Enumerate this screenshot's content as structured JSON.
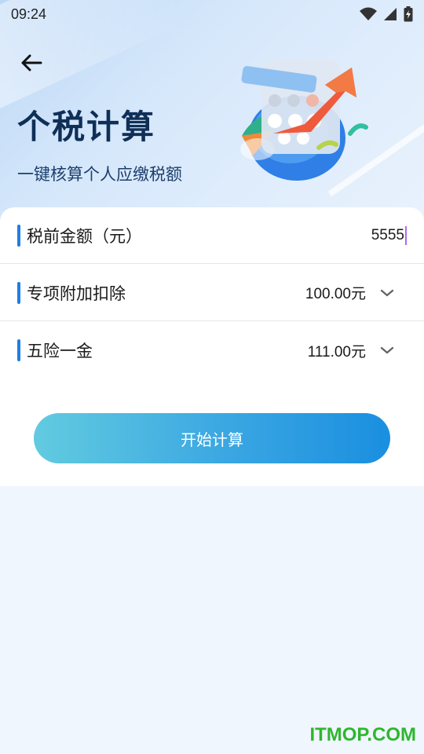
{
  "status_bar": {
    "time": "09:24",
    "icons": [
      "wifi-icon",
      "signal-icon",
      "battery-charging-icon"
    ]
  },
  "header": {
    "back_icon": "arrow-left-icon",
    "title": "个税计算",
    "subtitle": "一键核算个人应缴税额"
  },
  "form": {
    "pre_tax_amount": {
      "label": "税前金额（元）",
      "value": "5555"
    },
    "special_deduction": {
      "label": "专项附加扣除",
      "value": "100.00元",
      "icon": "chevron-down-icon"
    },
    "insurance_fund": {
      "label": "五险一金",
      "value": "111.00元",
      "icon": "chevron-down-icon"
    }
  },
  "actions": {
    "start_label": "开始计算"
  },
  "watermark": "ITMOP.COM",
  "colors": {
    "accent": "#1d7fe2",
    "title": "#0f2f57",
    "button_start": "#62cbe0",
    "button_end": "#1a8fe0",
    "watermark": "#2fb62f"
  }
}
